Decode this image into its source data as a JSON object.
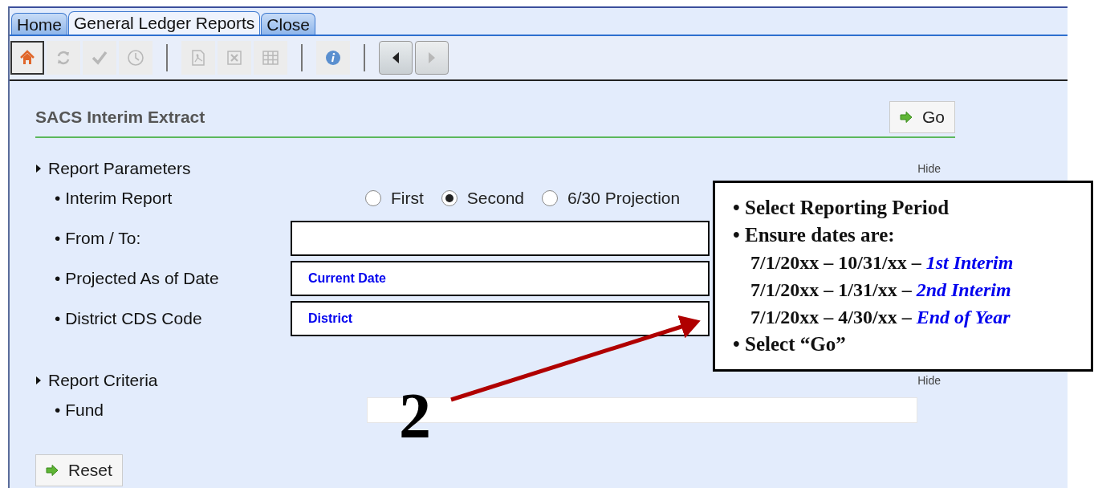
{
  "tabs": [
    {
      "label": "Home",
      "selected": false
    },
    {
      "label": "General Ledger Reports",
      "selected": true
    },
    {
      "label": "Close",
      "selected": false
    }
  ],
  "toolbar": [
    {
      "kind": "home",
      "selected": true,
      "disabled": false
    },
    {
      "kind": "refresh",
      "selected": false,
      "disabled": true
    },
    {
      "kind": "check",
      "selected": false,
      "disabled": true
    },
    {
      "kind": "clock",
      "selected": false,
      "disabled": true
    },
    {
      "kind": "separator"
    },
    {
      "kind": "pdf",
      "selected": false,
      "disabled": true
    },
    {
      "kind": "excel",
      "selected": false,
      "disabled": true
    },
    {
      "kind": "grid",
      "selected": false,
      "disabled": true
    },
    {
      "kind": "separator"
    },
    {
      "kind": "info",
      "selected": false,
      "disabled": false
    },
    {
      "kind": "separator"
    },
    {
      "kind": "prev",
      "disabled": false
    },
    {
      "kind": "next",
      "disabled": true
    }
  ],
  "panel": {
    "title": "SACS Interim Extract",
    "go_button": "Go",
    "sections": [
      {
        "title": "Report Parameters",
        "hide": "Hide",
        "rows": [
          {
            "kind": "radio",
            "label": "• Interim Report",
            "options": [
              {
                "label": "First",
                "selected": false
              },
              {
                "label": "Second",
                "selected": true
              },
              {
                "label": "6/30 Projection",
                "selected": false
              }
            ]
          },
          {
            "kind": "outlined",
            "label": "• From / To:"
          },
          {
            "kind": "outlined",
            "label": "• Projected As of Date",
            "value": "Current Date"
          },
          {
            "kind": "outlined",
            "label": "• District CDS Code",
            "value": "District"
          }
        ]
      },
      {
        "title": "Report Criteria",
        "hide": "Hide",
        "rows": [
          {
            "kind": "plain",
            "label": "• Fund"
          }
        ]
      }
    ],
    "reset_button": "Reset"
  },
  "callout": {
    "lines": [
      {
        "kind": "bullet",
        "text": "• Select Reporting Period"
      },
      {
        "kind": "bullet",
        "text": "• Ensure dates are:"
      },
      {
        "kind": "indent",
        "text": "7/1/20xx – 10/31/xx – *1st Interim*"
      },
      {
        "kind": "indent",
        "text": "7/1/20xx – 1/31/xx – *2nd Interim*"
      },
      {
        "kind": "indent",
        "text": "7/1/20xx – 4/30/xx – *End of Year*"
      },
      {
        "kind": "bullet",
        "text": "• Select “Go”"
      }
    ],
    "step_number": "2"
  }
}
